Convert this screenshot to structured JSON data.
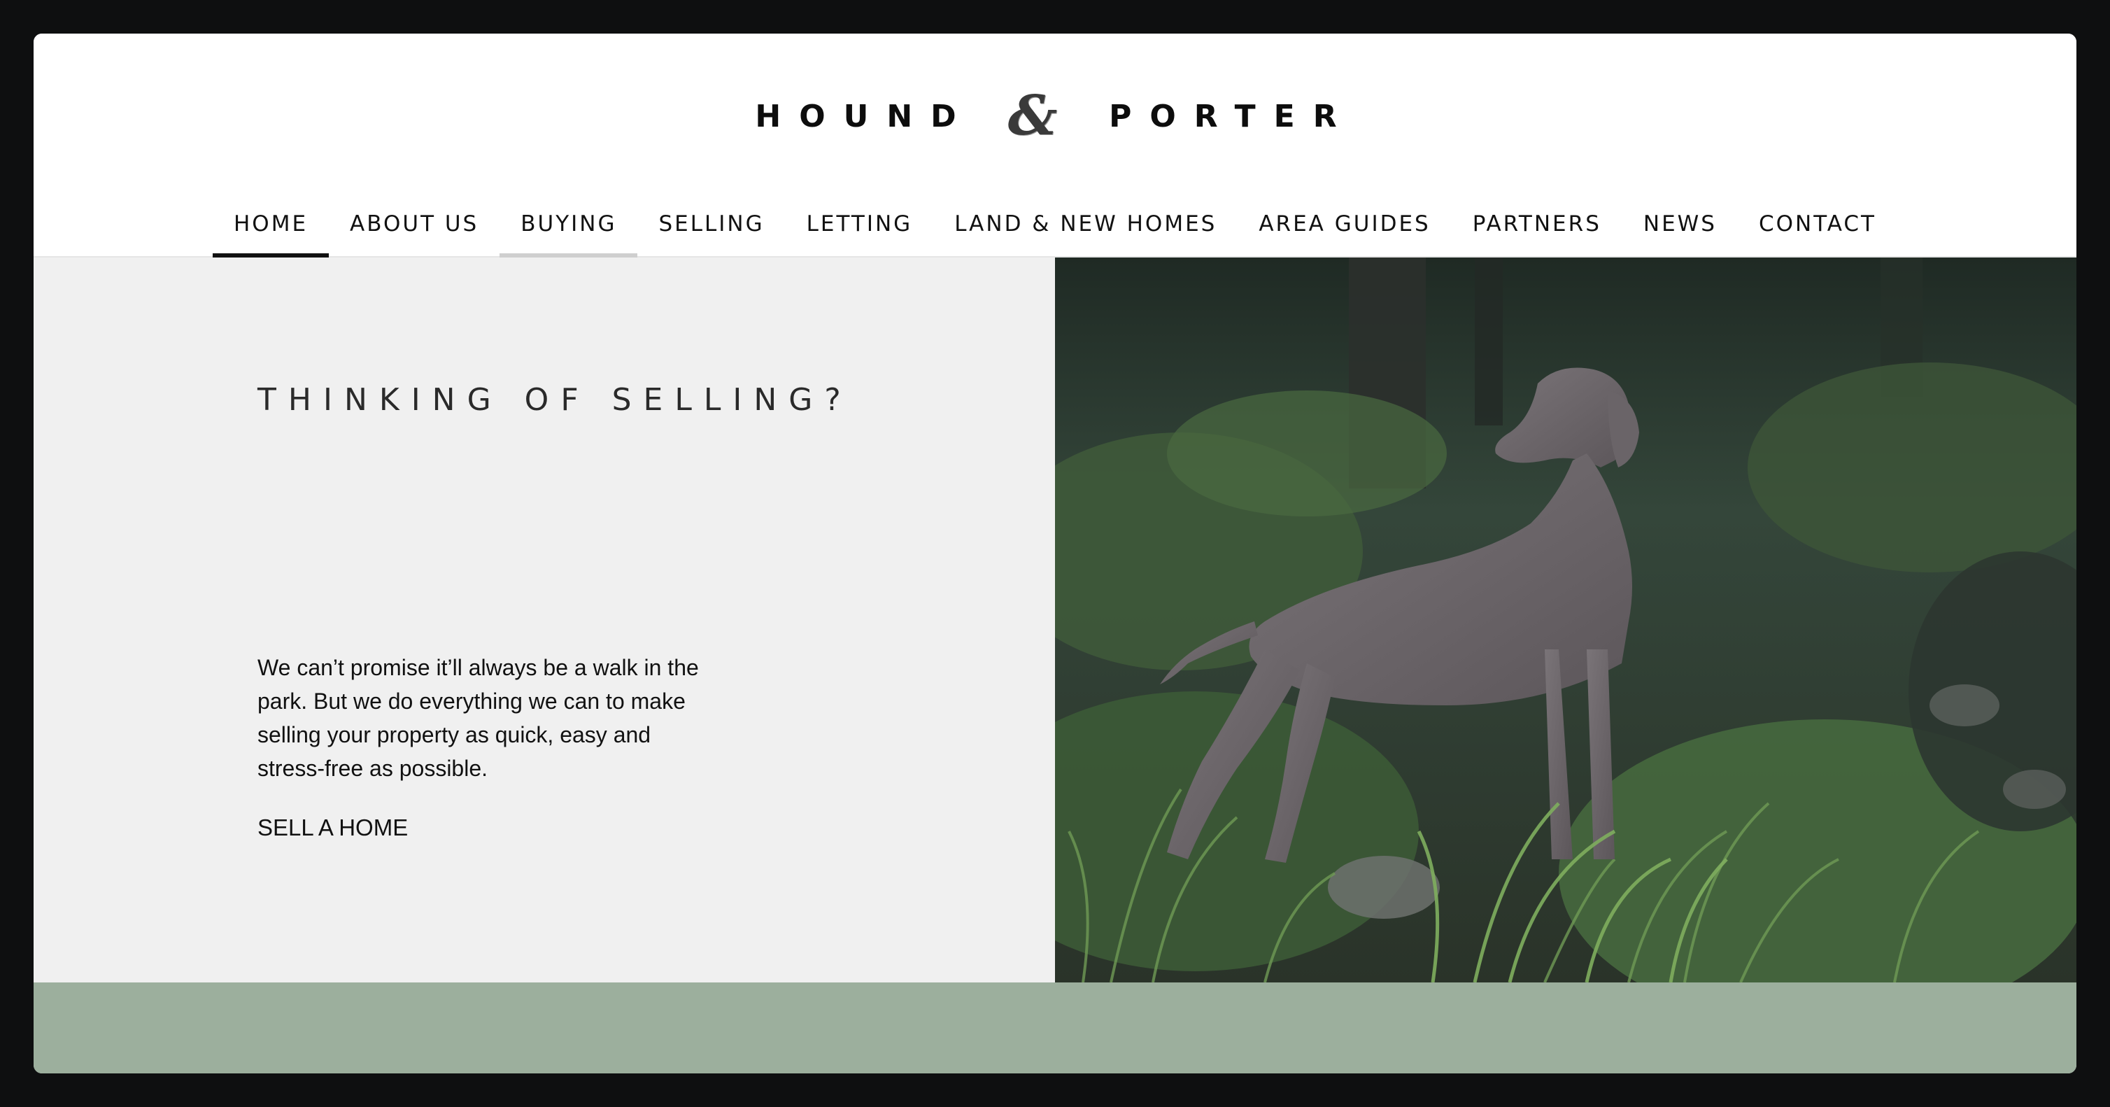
{
  "brand": {
    "word_left": "HOUND",
    "ampersand": "&",
    "word_right": "PORTER"
  },
  "nav": {
    "items": [
      {
        "label": "HOME",
        "state": "active"
      },
      {
        "label": "ABOUT US",
        "state": "default"
      },
      {
        "label": "BUYING",
        "state": "hover"
      },
      {
        "label": "SELLING",
        "state": "default"
      },
      {
        "label": "LETTING",
        "state": "default"
      },
      {
        "label": "LAND & NEW HOMES",
        "state": "default"
      },
      {
        "label": "AREA GUIDES",
        "state": "default"
      },
      {
        "label": "PARTNERS",
        "state": "default"
      },
      {
        "label": "NEWS",
        "state": "default"
      },
      {
        "label": "CONTACT",
        "state": "default"
      }
    ]
  },
  "hero": {
    "title": "THINKING OF SELLING?",
    "body": "We can’t promise it’ll always be a walk in the park. But we do everything we can to make selling your property as quick, easy and stress-free as possible.",
    "cta_label": "SELL A HOME",
    "image_subject": "dog-in-forest-photo"
  },
  "colors": {
    "page_bg": "#0e0f10",
    "hero_panel_bg": "#f0f0f0",
    "footer_band": "#9caf9d",
    "text": "#111111"
  }
}
